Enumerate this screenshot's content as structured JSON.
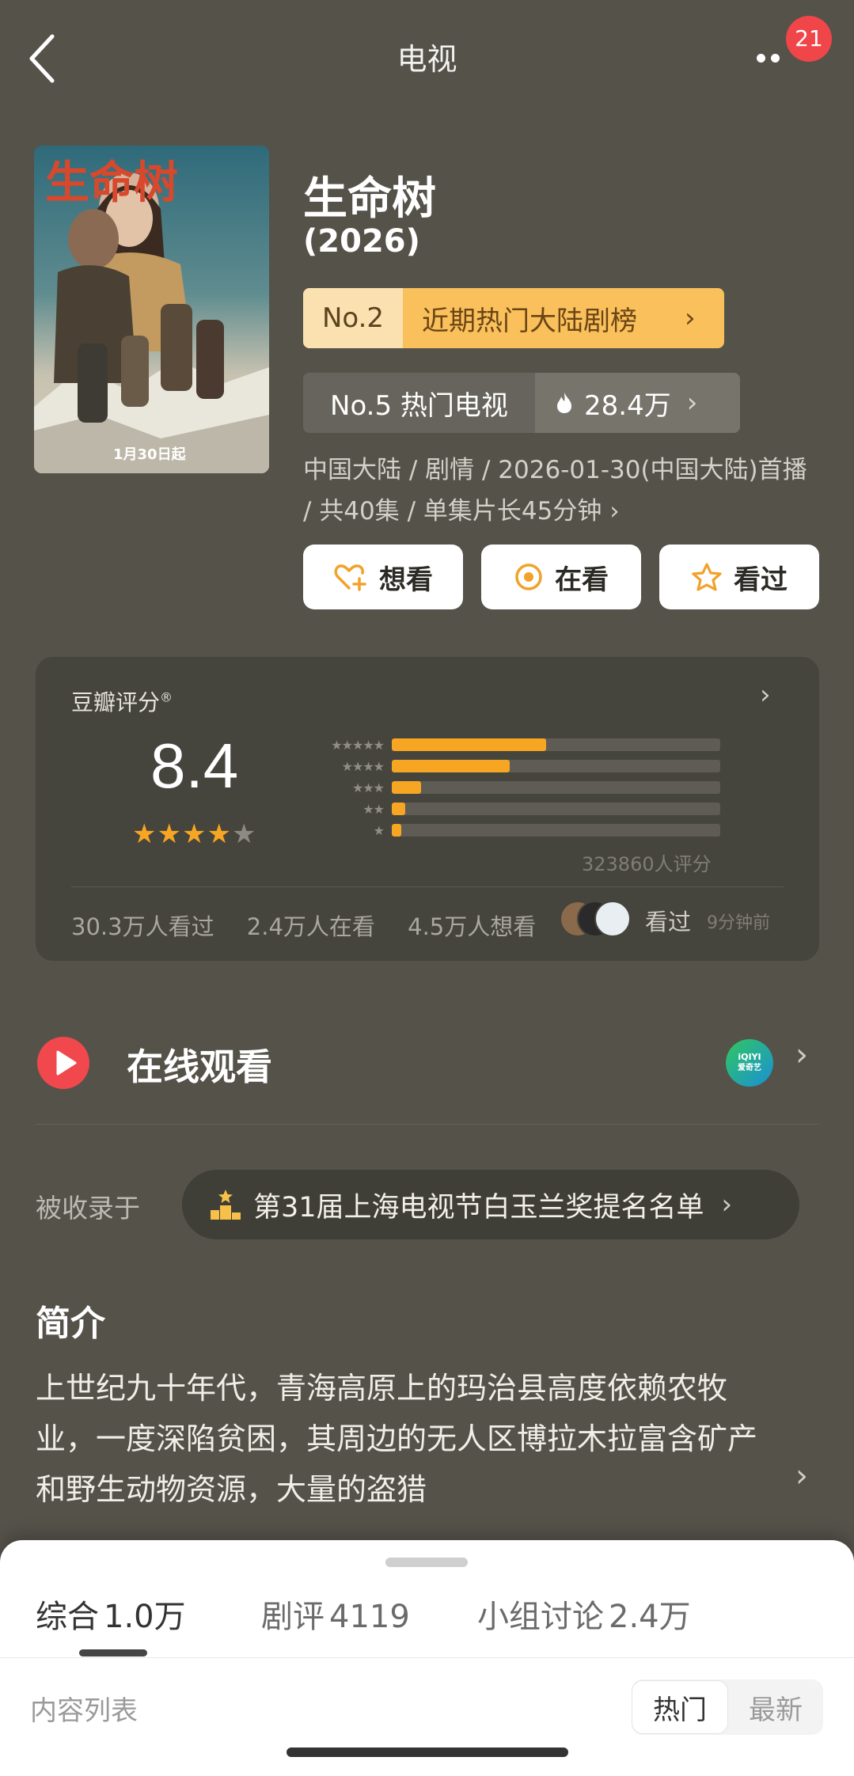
{
  "header": {
    "title": "电视",
    "notification_count": "21"
  },
  "movie": {
    "title": "生命树",
    "year": "(2026)",
    "poster_title": "生命树",
    "poster_date": "1月30日起",
    "rank": {
      "no": "No.2",
      "label": "近期热门大陆剧榜"
    },
    "hot": {
      "label": "No.5 热门电视",
      "value": "28.4万"
    },
    "meta": "中国大陆 / 剧情 / 2026-01-30(中国大陆)首播 / 共40集 / 单集片长45分钟 ›"
  },
  "actions": {
    "want": "想看",
    "watching": "在看",
    "watched": "看过"
  },
  "rating": {
    "label": "豆瓣评分",
    "label_sup": "®",
    "score": "8.4",
    "stars_filled": 4,
    "stars_total": 5,
    "count": "323860人评分",
    "distribution": [
      {
        "stars": "★★★★★",
        "percent": 47
      },
      {
        "stars": "★★★★",
        "percent": 36
      },
      {
        "stars": "★★★",
        "percent": 9
      },
      {
        "stars": "★★",
        "percent": 4
      },
      {
        "stars": "★",
        "percent": 3
      }
    ],
    "watched_count": "30.3万人看过",
    "watching_count": "2.4万人在看",
    "want_count": "4.5万人想看",
    "seen_text": "看过",
    "seen_time": "9分钟前"
  },
  "online": {
    "label": "在线观看",
    "platform_logo_line1": "iQIYI",
    "platform_logo_line2": "爱奇艺"
  },
  "collected": {
    "label": "被收录于",
    "item": "第31届上海电视节白玉兰奖提名名单"
  },
  "synopsis": {
    "title": "简介",
    "text": "上世纪九十年代，青海高原上的玛治县高度依赖农牧业，一度深陷贫困，其周边的无人区博拉木拉富含矿产和野生动物资源，大量的盗猎"
  },
  "sheet": {
    "tabs": [
      {
        "label": "综合",
        "count": "1.0万"
      },
      {
        "label": "剧评",
        "count": "4119"
      },
      {
        "label": "小组讨论",
        "count": "2.4万"
      }
    ],
    "content_list": "内容列表",
    "sort_hot": "热门",
    "sort_new": "最新"
  },
  "colors": {
    "background": "#545249",
    "accent_orange": "#f7a623",
    "badge_red": "#f0464a",
    "play_red": "#f0484c"
  }
}
